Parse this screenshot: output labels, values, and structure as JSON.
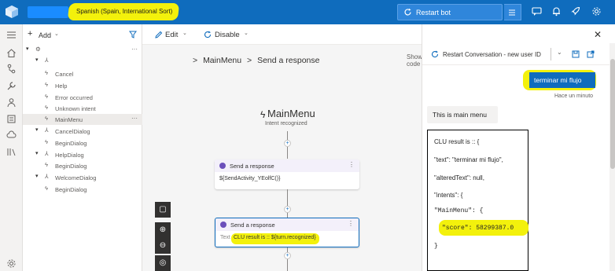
{
  "header": {
    "locale": "Spanish (Spain, International Sort)",
    "restart_label": "Restart bot"
  },
  "tree": {
    "add_label": "Add",
    "items": [
      {
        "label": "Cancel"
      },
      {
        "label": "Help"
      },
      {
        "label": "Error occurred"
      },
      {
        "label": "Unknown intent"
      },
      {
        "label": "MainMenu"
      },
      {
        "label": "CancelDialog"
      },
      {
        "label": "BeginDialog"
      },
      {
        "label": "HelpDialog"
      },
      {
        "label": "BeginDialog"
      },
      {
        "label": "WelcomeDialog"
      },
      {
        "label": "BeginDialog"
      }
    ]
  },
  "canvas": {
    "edit_label": "Edit",
    "disable_label": "Disable",
    "breadcrumb_1": "MainMenu",
    "breadcrumb_sep": ">",
    "breadcrumb_2": "Send a response",
    "show_code": "Show code",
    "trigger_title": "MainMenu",
    "trigger_subtitle": "Intent recognized",
    "node1_title": "Send a response",
    "node1_body": "${SendActivity_YEolfC()}",
    "node2_title": "Send a response",
    "node2_prefix": "Text",
    "node2_body": "CLU result is :: ${turn.recognized}"
  },
  "chat": {
    "restart_conversation": "Restart Conversation - new user ID",
    "user_message": "terminar mi flujo",
    "timestamp": "Hace un minuto",
    "bot_message": "This is main menu",
    "clu_lines": [
      "CLU result is :: {",
      "\"text\": \"terminar mi flujo\",",
      "\"alteredText\": null,",
      "\"intents\": {",
      "\"MainMenu\": {",
      "\"score\": 58299387.0",
      "}"
    ]
  },
  "colors": {
    "accent": "#0f6cbd",
    "highlight": "#f3f10c",
    "node_dot": "#6b4fbb"
  }
}
